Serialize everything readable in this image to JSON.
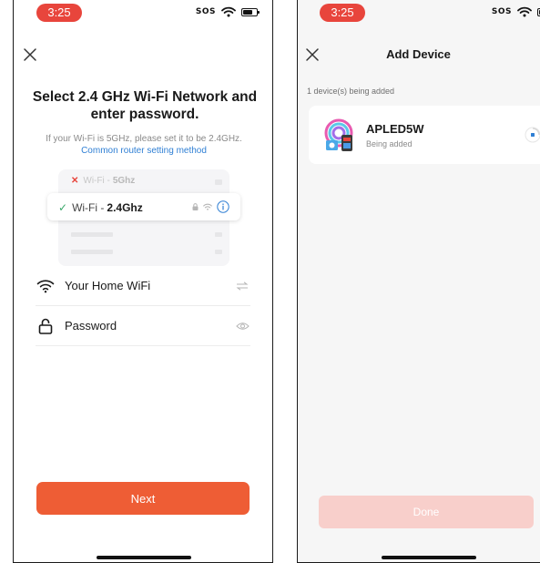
{
  "left_screen": {
    "status_bar": {
      "time": "3:25",
      "carrier": "SOS"
    },
    "title": "Select 2.4 GHz Wi-Fi Network and enter password.",
    "hint": "If your Wi-Fi is 5GHz, please set it to be 2.4GHz.",
    "router_link": "Common router setting method",
    "illustration": {
      "bad_network_prefix": "Wi-Fi - ",
      "bad_network_band": "5Ghz",
      "good_network_prefix": "Wi-Fi - ",
      "good_network_band": "2.4Ghz"
    },
    "wifi_field": {
      "value": "Your Home WiFi"
    },
    "password_field": {
      "placeholder": "Password"
    },
    "next_button": "Next"
  },
  "right_screen": {
    "status_bar": {
      "time": "3:25",
      "carrier": "SOS"
    },
    "title": "Add Device",
    "device_count": "1 device(s) being added",
    "device": {
      "name": "APLED5W",
      "status": "Being added"
    },
    "done_button": "Done"
  },
  "colors": {
    "accent": "#ee5d35",
    "accent_disabled": "#f8cfcb",
    "link": "#2f7fd4",
    "time_pill": "#e8453c",
    "check": "#3aa86b"
  },
  "icons": [
    "close-icon",
    "wifi-icon",
    "lock-icon",
    "swap-icon",
    "eye-icon",
    "info-icon",
    "signal-icon",
    "battery-icon",
    "check-icon",
    "cross-icon",
    "spinner-icon"
  ]
}
